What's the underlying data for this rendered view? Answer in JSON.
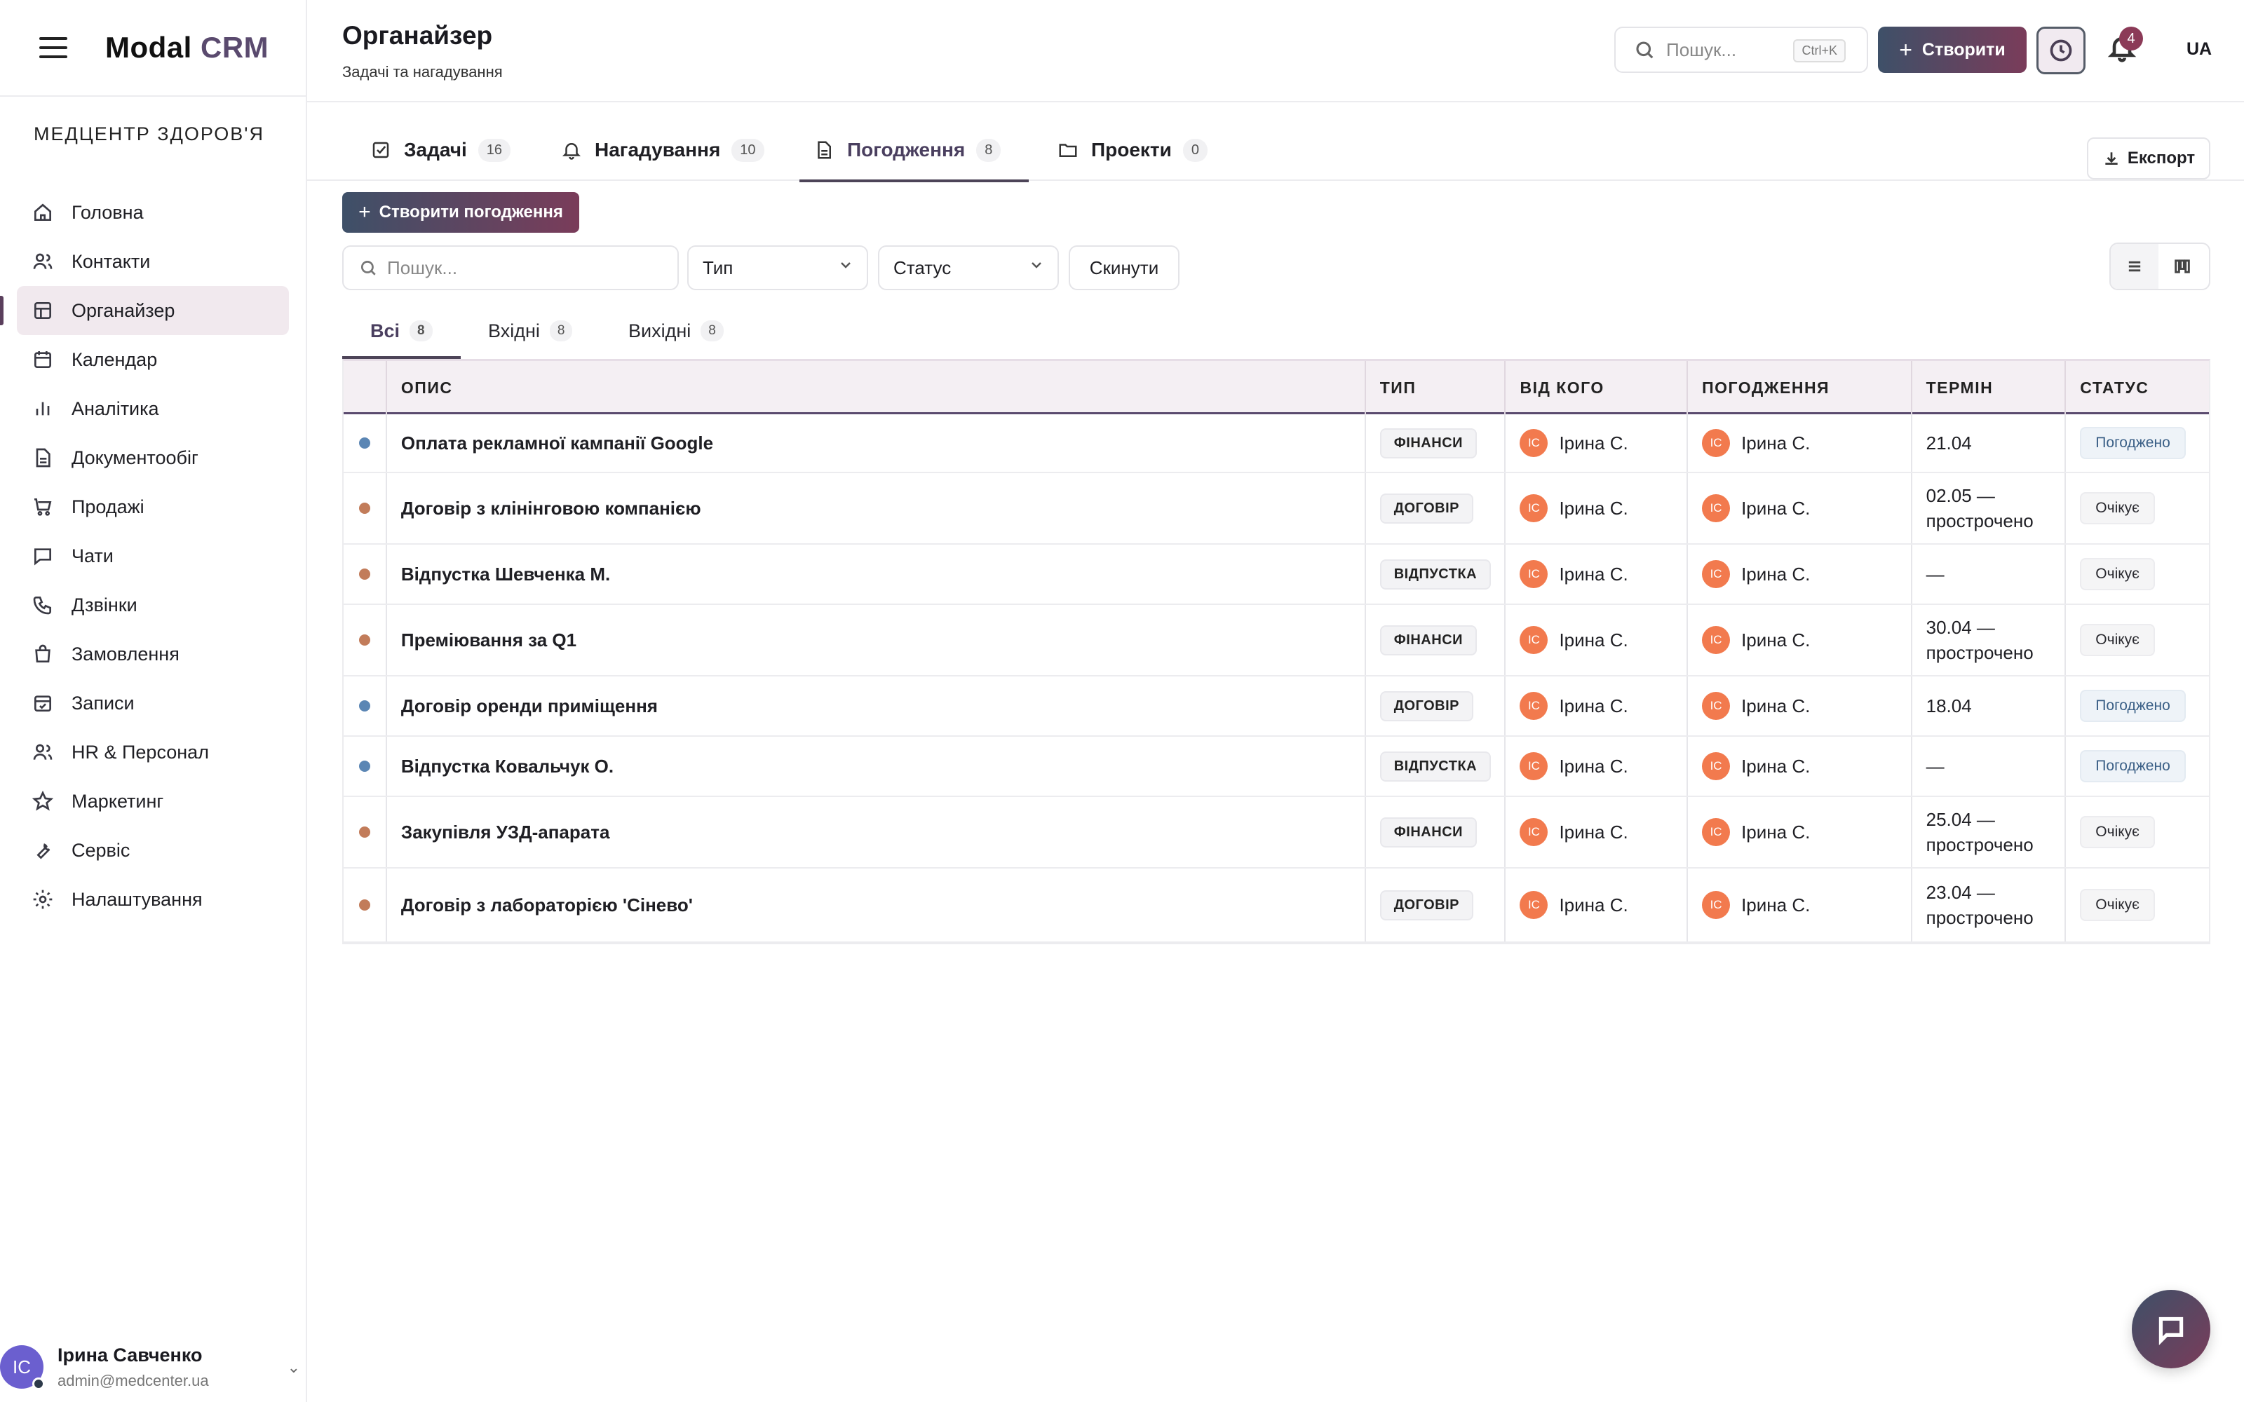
{
  "app": {
    "brand_main": "Modal",
    "brand_accent": "CRM",
    "org": "МЕДЦЕНТР ЗДОРОВ'Я"
  },
  "sidebar": {
    "items": [
      {
        "label": "Головна",
        "icon": "home-icon"
      },
      {
        "label": "Контакти",
        "icon": "users-icon"
      },
      {
        "label": "Органайзер",
        "icon": "layout-icon",
        "active": true
      },
      {
        "label": "Календар",
        "icon": "calendar-icon"
      },
      {
        "label": "Аналітика",
        "icon": "chart-icon"
      },
      {
        "label": "Документообіг",
        "icon": "document-icon"
      },
      {
        "label": "Продажі",
        "icon": "cart-icon"
      },
      {
        "label": "Чати",
        "icon": "chat-icon"
      },
      {
        "label": "Дзвінки",
        "icon": "phone-icon"
      },
      {
        "label": "Замовлення",
        "icon": "bag-icon"
      },
      {
        "label": "Записи",
        "icon": "calendar-check-icon"
      },
      {
        "label": "HR & Персонал",
        "icon": "team-icon"
      },
      {
        "label": "Маркетинг",
        "icon": "star-icon"
      },
      {
        "label": "Сервіс",
        "icon": "wrench-icon"
      },
      {
        "label": "Налаштування",
        "icon": "gear-icon"
      }
    ]
  },
  "user": {
    "initials": "IC",
    "name": "Ірина Савченко",
    "email": "admin@medcenter.ua"
  },
  "header": {
    "title": "Органайзер",
    "subtitle": "Задачі та нагадування",
    "search_placeholder": "Пошук...",
    "search_shortcut": "Ctrl+K",
    "create_label": "Створити",
    "notifications_count": "4",
    "lang": "UA"
  },
  "tabs": [
    {
      "label": "Задачі",
      "count": "16",
      "icon": "checkbox-icon"
    },
    {
      "label": "Нагадування",
      "count": "10",
      "icon": "bell-icon"
    },
    {
      "label": "Погодження",
      "count": "8",
      "icon": "file-icon",
      "active": true
    },
    {
      "label": "Проекти",
      "count": "0",
      "icon": "folder-icon"
    }
  ],
  "export_label": "Експорт",
  "toolbar": {
    "create_approval": "Створити погодження",
    "search_placeholder": "Пошук...",
    "type_select": "Тип",
    "status_select": "Статус",
    "reset": "Скинути"
  },
  "subtabs": [
    {
      "label": "Всі",
      "count": "8",
      "active": true
    },
    {
      "label": "Вхідні",
      "count": "8"
    },
    {
      "label": "Вихідні",
      "count": "8"
    }
  ],
  "table": {
    "headers": [
      "ОПИС",
      "ТИП",
      "ВІД КОГО",
      "ПОГОДЖЕННЯ",
      "ТЕРМІН",
      "СТАТУС"
    ],
    "rows": [
      {
        "desc": "Оплата рекламної кампанії Google",
        "type": "ФІНАНСИ",
        "from": "Ірина С.",
        "approver": "Ірина С.",
        "term": "21.04",
        "status": "Погоджено",
        "state": "ok"
      },
      {
        "desc": "Договір з клінінговою компанією",
        "type": "ДОГОВІР",
        "from": "Ірина С.",
        "approver": "Ірина С.",
        "term": "02.05 — прострочено",
        "status": "Очікує",
        "state": "wait"
      },
      {
        "desc": "Відпустка Шевченка М.",
        "type": "ВІДПУСТКА",
        "from": "Ірина С.",
        "approver": "Ірина С.",
        "term": "—",
        "status": "Очікує",
        "state": "wait"
      },
      {
        "desc": "Преміювання за Q1",
        "type": "ФІНАНСИ",
        "from": "Ірина С.",
        "approver": "Ірина С.",
        "term": "30.04 — прострочено",
        "status": "Очікує",
        "state": "wait"
      },
      {
        "desc": "Договір оренди приміщення",
        "type": "ДОГОВІР",
        "from": "Ірина С.",
        "approver": "Ірина С.",
        "term": "18.04",
        "status": "Погоджено",
        "state": "ok"
      },
      {
        "desc": "Відпустка Ковальчук О.",
        "type": "ВІДПУСТКА",
        "from": "Ірина С.",
        "approver": "Ірина С.",
        "term": "—",
        "status": "Погоджено",
        "state": "ok"
      },
      {
        "desc": "Закупівля УЗД-апарата",
        "type": "ФІНАНСИ",
        "from": "Ірина С.",
        "approver": "Ірина С.",
        "term": "25.04 — прострочено",
        "status": "Очікує",
        "state": "wait"
      },
      {
        "desc": "Договір з лабораторією 'Сінево'",
        "type": "ДОГОВІР",
        "from": "Ірина С.",
        "approver": "Ірина С.",
        "term": "23.04 — прострочено",
        "status": "Очікує",
        "state": "wait"
      }
    ],
    "avatar_initials": "IC"
  },
  "colors": {
    "dot_ok": "#5b86b4",
    "dot_wait": "#c27c5a",
    "accent": "#5a4a6e"
  }
}
